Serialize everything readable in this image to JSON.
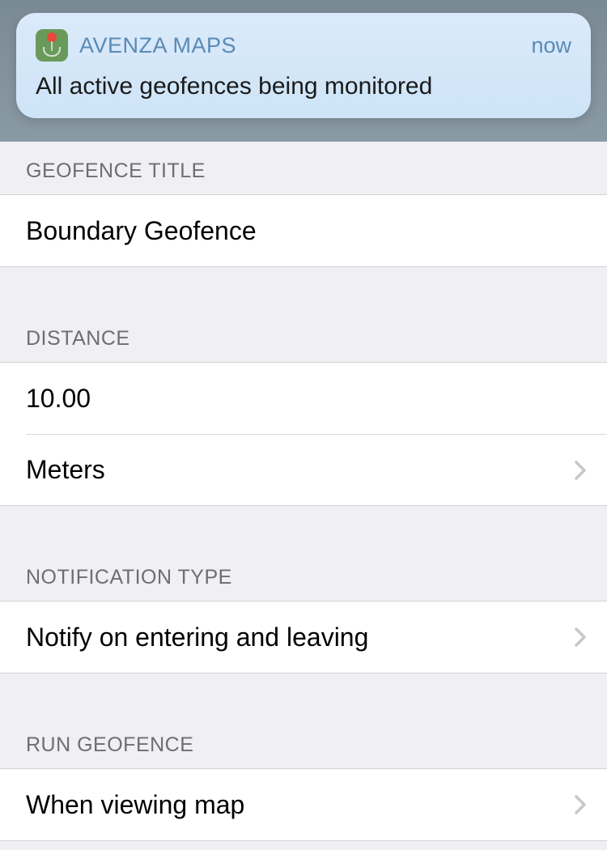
{
  "notification": {
    "app_name": "AVENZA MAPS",
    "time": "now",
    "message": "All active geofences being monitored"
  },
  "sections": {
    "geofence_title": {
      "header": "GEOFENCE TITLE",
      "value": "Boundary Geofence"
    },
    "distance": {
      "header": "DISTANCE",
      "value": "10.00",
      "unit": "Meters"
    },
    "notification_type": {
      "header": "NOTIFICATION TYPE",
      "value": "Notify on entering and leaving"
    },
    "run_geofence": {
      "header": "RUN GEOFENCE",
      "value": "When viewing map"
    }
  }
}
